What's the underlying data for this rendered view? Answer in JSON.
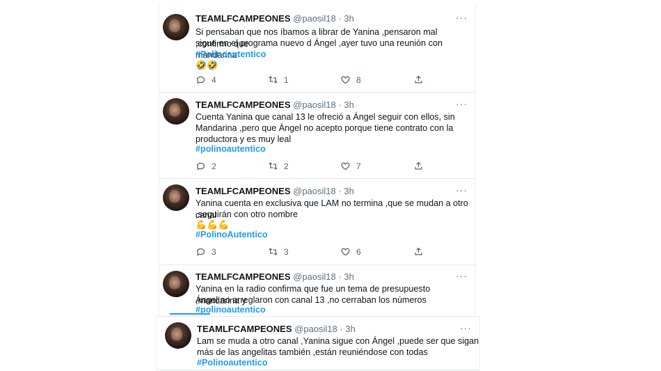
{
  "tweets": [
    {
      "name": "TEAMLFCAMPEONES",
      "handle": "@paosil18",
      "dot": "·",
      "time": "3h",
      "more": "···",
      "lines": [
        "Si pensaban que nos íbamos a librar de Yanina ,pensaron mal ,confirmo que",
        "sigue en el programa nuevo d Ángel ,ayer tuvo una reunión con mandarina"
      ],
      "hashtag": "#Polinoautentico",
      "emoji": "🤣🤣",
      "reply_count": "4",
      "retweet_count": "1",
      "like_count": "8"
    },
    {
      "name": "TEAMLFCAMPEONES",
      "handle": "@paosil18",
      "dot": "·",
      "time": "3h",
      "more": "···",
      "lines": [
        "Cuenta Yanina que canal 13 le ofreció a Ángel seguir con ellos, sin",
        "Mandarina ,pero que Ángel no acepto porque tiene contrato con la",
        "productora y es muy leal"
      ],
      "hashtag": "#polinoautentico",
      "emoji": "",
      "reply_count": "2",
      "retweet_count": "2",
      "like_count": "7"
    },
    {
      "name": "TEAMLFCAMPEONES",
      "handle": "@paosil18",
      "dot": "·",
      "time": "3h",
      "more": "···",
      "lines": [
        "Yanina cuenta en exclusiva que LAM no termina ,que se mudan a otro canal",
        ",seguirán con otro nombre"
      ],
      "hashtag": "#PolinoAutentico",
      "emoji": "💪💪💪",
      "reply_count": "3",
      "retweet_count": "3",
      "like_count": "6"
    },
    {
      "name": "TEAMLFCAMPEONES",
      "handle": "@paosil18",
      "dot": "·",
      "time": "3h",
      "more": "···",
      "lines": [
        "Yanina en la radio confirma que fue un tema de presupuesto ,mandarina y",
        "Ángel no arreglaron con canal 13 ,no cerraban los números"
      ],
      "hashtag": "#polinoautentico",
      "emoji": ""
    },
    {
      "name": "TEAMLFCAMPEONES",
      "handle": "@paosil18",
      "dot": "·",
      "time": "3h",
      "more": "···",
      "lines": [
        "Lam se muda a otro canal ,Yanina sigue con Ángel ,puede ser que sigan",
        "más de las angelitas también ,están reuniéndose con todas"
      ],
      "hashtag": "#Polinoautentico",
      "emoji": ""
    }
  ],
  "colors": {
    "link": "#1d9bf0",
    "secondary": "#5b7083",
    "text": "#0f1419"
  },
  "icons": [
    "reply-icon",
    "retweet-icon",
    "like-icon",
    "share-icon",
    "more-icon"
  ]
}
